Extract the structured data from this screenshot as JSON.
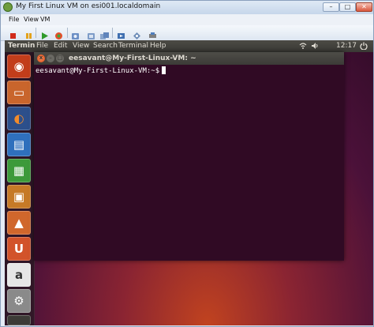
{
  "window": {
    "title": "My First Linux VM on esi001.localdomain",
    "min_glyph": "–",
    "max_glyph": "□",
    "close_glyph": "✕"
  },
  "menubar": {
    "items": [
      "File",
      "View",
      "VM"
    ]
  },
  "toolbar": {
    "icons": [
      "stop-icon",
      "pause-icon",
      "play-icon",
      "reset-icon",
      "snapshot-icon",
      "revert-icon",
      "manage-snapshots-icon",
      "console-settings-icon",
      "send-ctrl-alt-del-icon",
      "connect-device-icon"
    ]
  },
  "panel": {
    "app_name": "Termin",
    "menus": [
      "File",
      "Edit",
      "View",
      "Search",
      "Terminal",
      "Help"
    ],
    "clock": "12:17",
    "indicators": [
      "network-icon",
      "volume-icon",
      "power-icon"
    ]
  },
  "launcher": {
    "items": [
      {
        "name": "dash-icon",
        "color": "#b83b1b",
        "sym": "◉"
      },
      {
        "name": "files-icon",
        "color": "#c3602b",
        "sym": "▭"
      },
      {
        "name": "firefox-icon",
        "color": "#2a4f8f",
        "sym": "◐"
      },
      {
        "name": "writer-icon",
        "color": "#2e70c0",
        "sym": "▤"
      },
      {
        "name": "calc-icon",
        "color": "#3d9a3a",
        "sym": "▦"
      },
      {
        "name": "impress-icon",
        "color": "#c67a27",
        "sym": "▣"
      },
      {
        "name": "software-center-icon",
        "color": "#d0672c",
        "sym": "▲"
      },
      {
        "name": "ubuntu-one-icon",
        "color": "#d2532a",
        "sym": "U"
      },
      {
        "name": "amazon-icon",
        "color": "#e0e0e0",
        "sym": "a"
      },
      {
        "name": "settings-icon",
        "color": "#888888",
        "sym": "⚙"
      },
      {
        "name": "terminal-icon",
        "color": "#3c3b37",
        "sym": ">_"
      }
    ]
  },
  "terminal": {
    "title": "eesavant@My-First-Linux-VM: ~",
    "prompt": "eesavant@My-First-Linux-VM:~$",
    "close_glyph": "x",
    "min_glyph": "–",
    "max_glyph": "□"
  },
  "colors": {
    "terminal_bg": "#300a24",
    "panel_bg": "#3c3b37",
    "ubuntu_orange": "#dd4814"
  }
}
